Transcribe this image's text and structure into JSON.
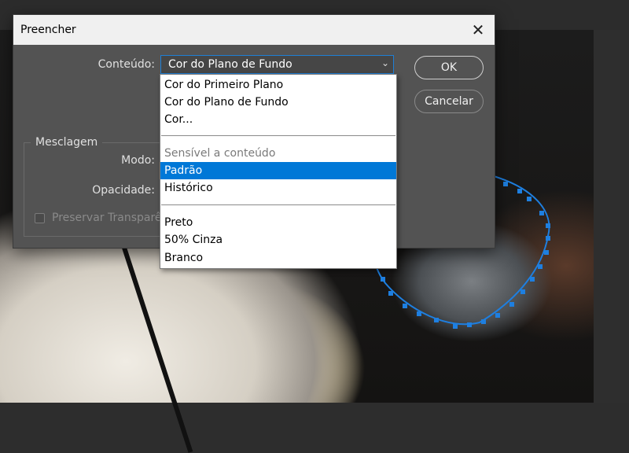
{
  "dialog": {
    "title": "Preencher",
    "content_label": "Conteúdo:",
    "content_value": "Cor do Plano de Fundo",
    "ok_label": "OK",
    "cancel_label": "Cancelar",
    "blend_group_title": "Mesclagem",
    "mode_label": "Modo:",
    "opacity_label": "Opacidade:",
    "preserve_transparency_label": "Preservar Transparên"
  },
  "dropdown": {
    "options": [
      "Cor do Primeiro Plano",
      "Cor do Plano de Fundo",
      "Cor...",
      "Sensível a conteúdo",
      "Padrão",
      "Histórico",
      "Preto",
      "50% Cinza",
      "Branco"
    ],
    "selected": "Padrão"
  },
  "colors": {
    "accent": "#0078d7",
    "dialog_bg": "#535353",
    "selection_path": "#1e7fe0"
  }
}
